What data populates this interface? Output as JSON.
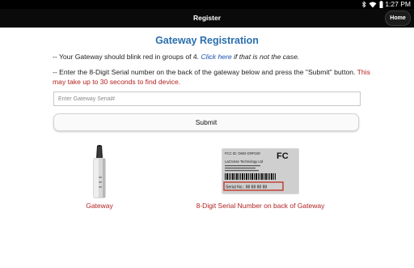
{
  "status_bar": {
    "time": "1:27 PM",
    "icons": [
      "bluetooth-icon",
      "wifi-icon",
      "battery-icon"
    ]
  },
  "app_bar": {
    "title": "Register",
    "home_label": "Home"
  },
  "main": {
    "heading": "Gateway Registration",
    "line1_prefix": "-- Your Gateway should blink red in groups of 4.",
    "line1_link": "Click here",
    "line1_suffix": "if that is not the case.",
    "line2_text": "-- Enter the 8-Digit Serial number on the back of the gateway below and press the \"Submit\" button.",
    "line2_note": "This may take up to 30 seconds to find device.",
    "serial_placeholder": "Enter Gateway Serial#",
    "serial_value": "",
    "submit_label": "Submit"
  },
  "images": {
    "gateway_caption": "Gateway",
    "label_caption": "8-Digit Serial Number on back of Gateway",
    "label_fcc": "FCC ID: OMO-GRP100",
    "label_fc_logo": "FC",
    "label_company": "LaCrosse Technology Ltd",
    "label_serial": "Serial No.: 88 88 88 88"
  },
  "colors": {
    "heading_blue": "#2a6fae",
    "link_blue": "#1a4fb0",
    "note_red": "#b22222",
    "app_bar_black": "#0a0a0a"
  }
}
